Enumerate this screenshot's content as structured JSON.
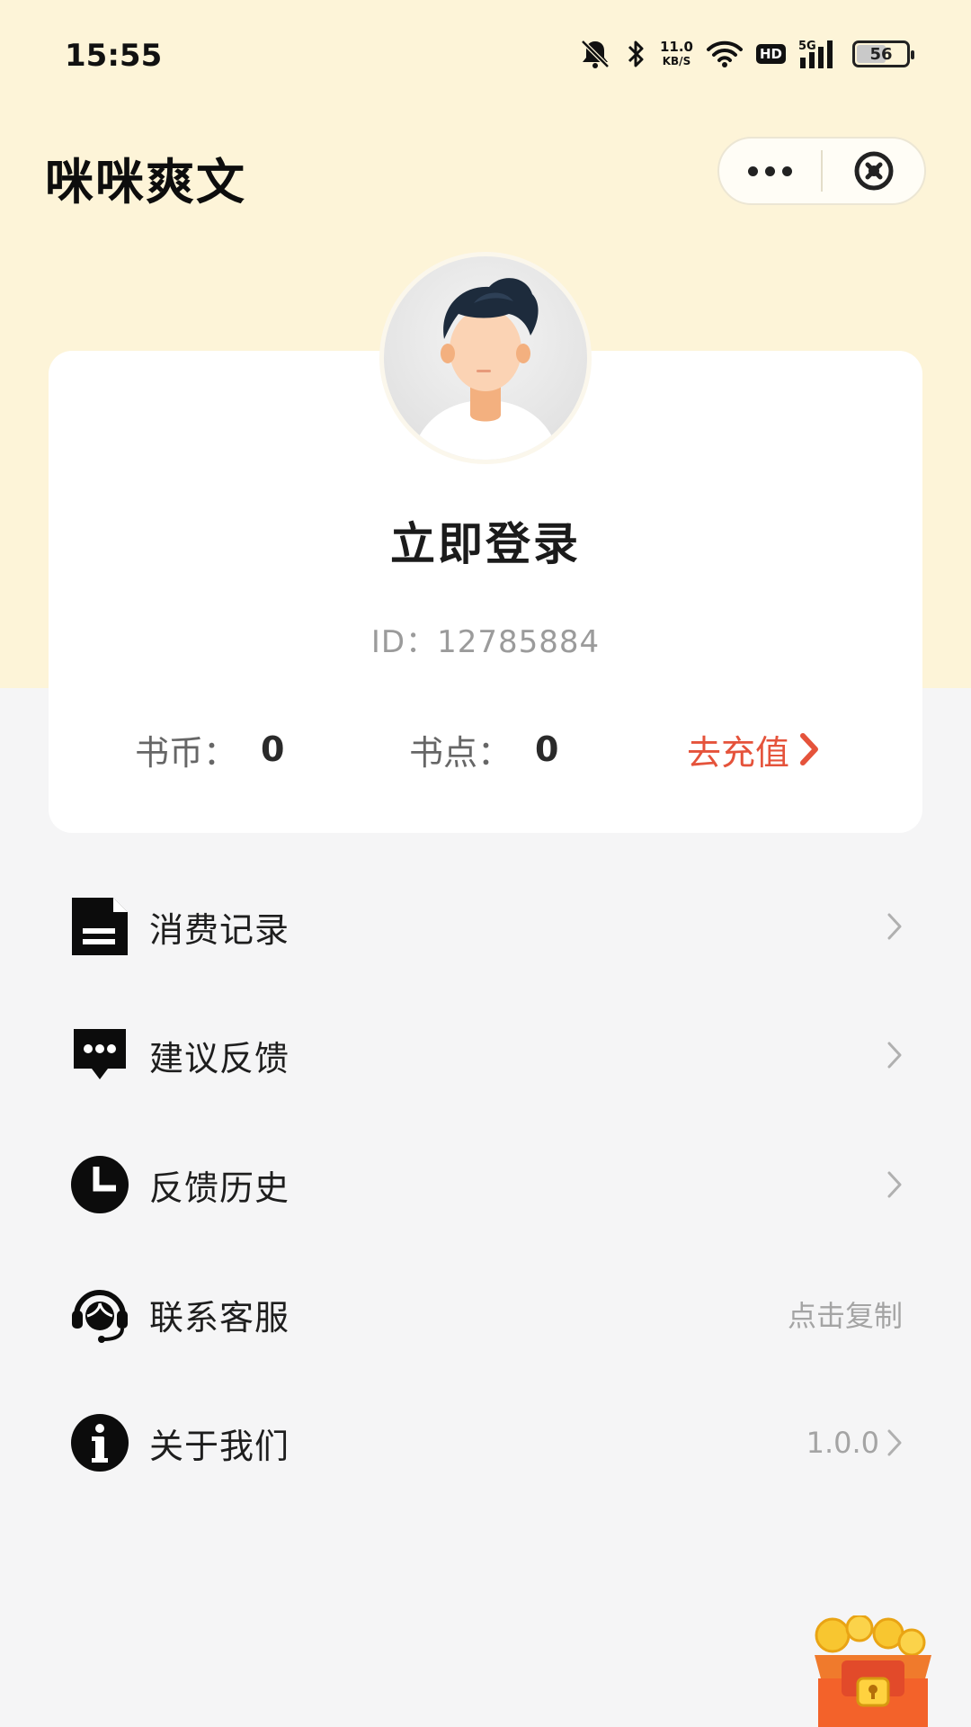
{
  "status_bar": {
    "time": "15:55",
    "net_speed_value": "11.0",
    "net_speed_unit": "KB/S",
    "hd_label": "HD",
    "signal_label": "5G",
    "battery": "56",
    "icons": [
      "mute-bell-icon",
      "bluetooth-icon",
      "wifi-icon",
      "signal-icon",
      "battery-icon"
    ]
  },
  "header": {
    "title": "咪咪爽文",
    "capsule_icons": [
      "more-icon",
      "close-circle-icon"
    ]
  },
  "profile": {
    "login_label": "立即登录",
    "id_text": "ID：12785884",
    "coins_label": "书币：",
    "coins_value": "0",
    "points_label": "书点：",
    "points_value": "0",
    "recharge_label": "去充值",
    "accent_color": "#e5533b"
  },
  "menu": {
    "items": [
      {
        "label": "消费记录",
        "icon": "document-icon",
        "right": ""
      },
      {
        "label": "建议反馈",
        "icon": "chat-bubble-icon",
        "right": ""
      },
      {
        "label": "反馈历史",
        "icon": "clock-icon",
        "right": ""
      },
      {
        "label": "联系客服",
        "icon": "headset-icon",
        "right": "点击复制"
      },
      {
        "label": "关于我们",
        "icon": "info-icon",
        "right": "1.0.0"
      }
    ]
  },
  "colors": {
    "top_background": "#fdf4d8",
    "page_background": "#f5f5f6"
  }
}
